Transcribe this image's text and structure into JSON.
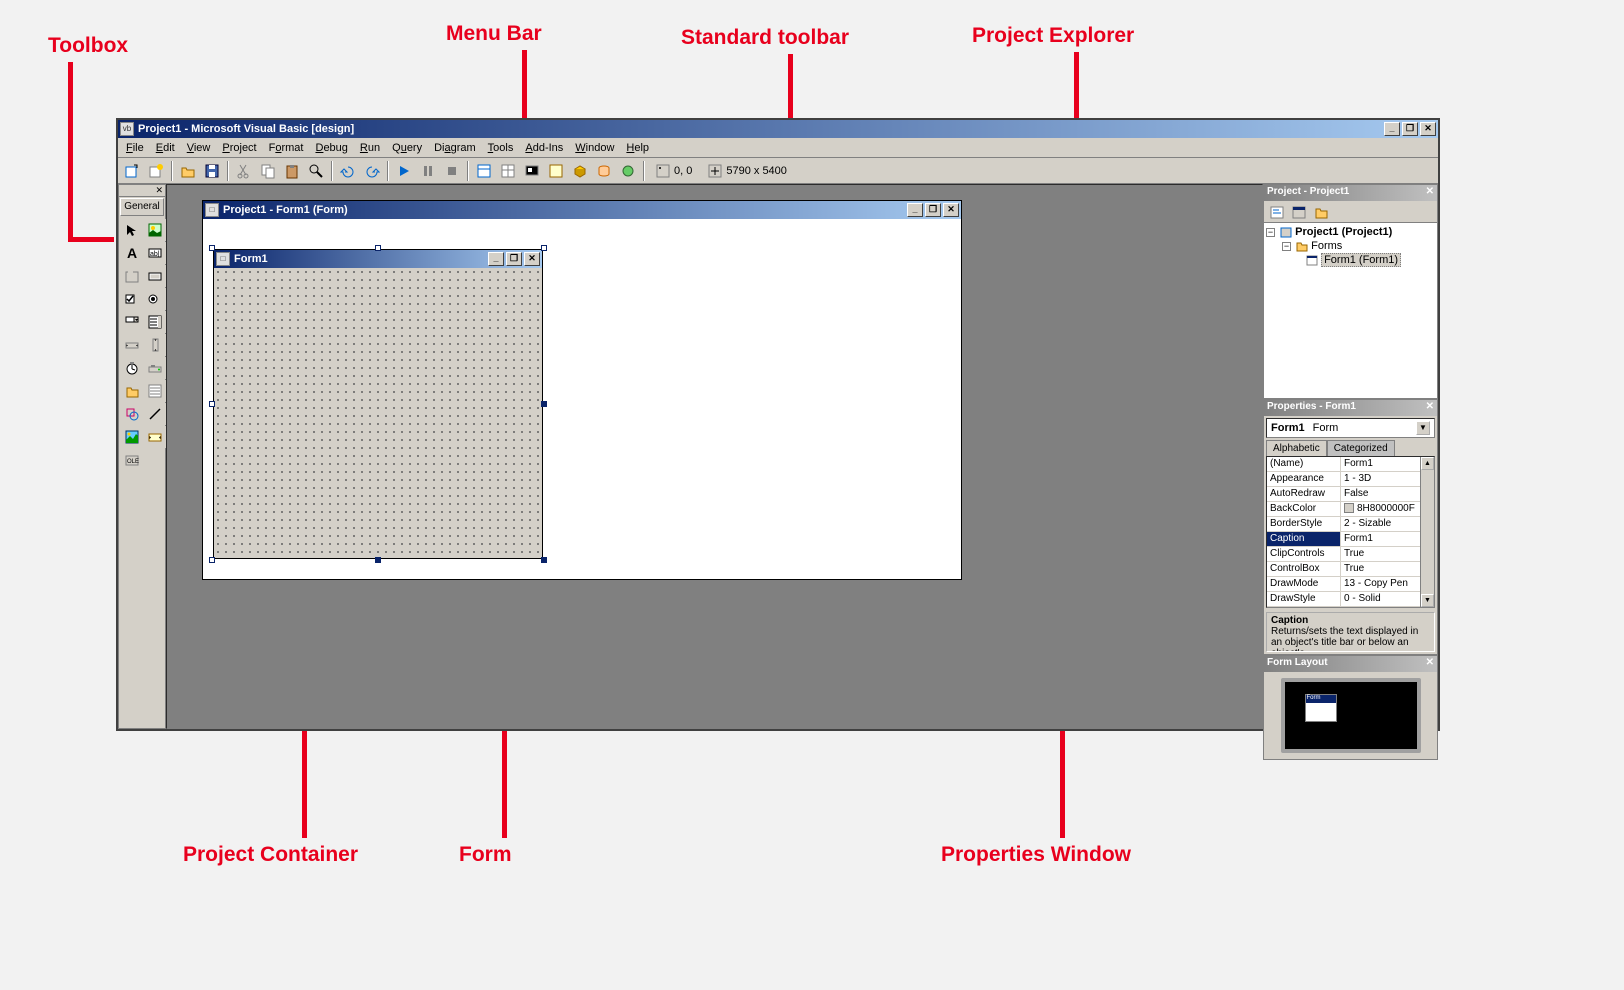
{
  "title": "Project1 - Microsoft Visual Basic [design]",
  "annotations": {
    "toolbox": "Toolbox",
    "menubar": "Menu Bar",
    "stdtoolbar": "Standard toolbar",
    "prjexplorer": "Project Explorer",
    "prjcontainer": "Project Container",
    "form": "Form",
    "propwin": "Properties Window"
  },
  "menu": [
    "File",
    "Edit",
    "View",
    "Project",
    "Format",
    "Debug",
    "Run",
    "Query",
    "Diagram",
    "Tools",
    "Add-Ins",
    "Window",
    "Help"
  ],
  "toolbar_status": {
    "pos": "0, 0",
    "size": "5790 x 5400"
  },
  "toolbox_tab": "General",
  "formwin_title": "Project1 - Form1 (Form)",
  "form_caption": "Form1",
  "project_panel": {
    "title": "Project - Project1",
    "root": "Project1 (Project1)",
    "folder": "Forms",
    "item": "Form1 (Form1)"
  },
  "props_panel": {
    "title": "Properties - Form1",
    "object": "Form1",
    "objtype": "Form",
    "tabs": [
      "Alphabetic",
      "Categorized"
    ],
    "rows": [
      {
        "name": "(Name)",
        "val": "Form1"
      },
      {
        "name": "Appearance",
        "val": "1 - 3D"
      },
      {
        "name": "AutoRedraw",
        "val": "False"
      },
      {
        "name": "BackColor",
        "val": "8H8000000F",
        "color": true
      },
      {
        "name": "BorderStyle",
        "val": "2 - Sizable"
      },
      {
        "name": "Caption",
        "val": "Form1",
        "sel": true
      },
      {
        "name": "ClipControls",
        "val": "True"
      },
      {
        "name": "ControlBox",
        "val": "True"
      },
      {
        "name": "DrawMode",
        "val": "13 - Copy Pen"
      },
      {
        "name": "DrawStyle",
        "val": "0 - Solid"
      }
    ],
    "desc_title": "Caption",
    "desc_text": "Returns/sets the text displayed in an object's title bar or below an object's"
  },
  "layout_panel": {
    "title": "Form Layout",
    "mini": "Form"
  }
}
